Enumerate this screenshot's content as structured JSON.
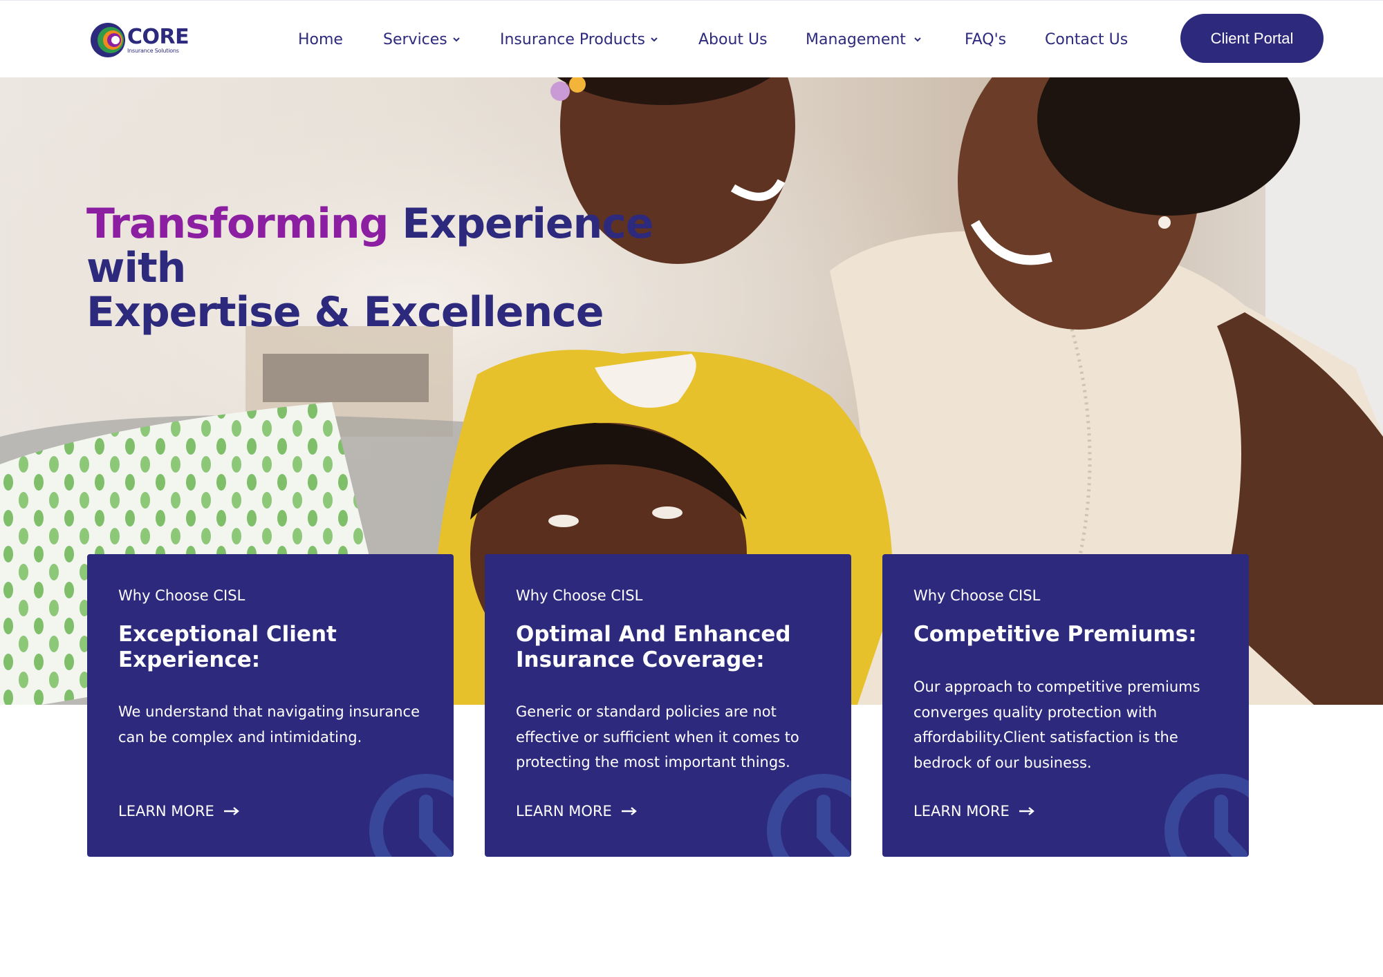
{
  "brand": {
    "name": "CORE",
    "tagline": "Insurance Solutions",
    "colors": {
      "primary": "#2d2a7e",
      "accent": "#8c1fa1",
      "logo_green": "#2e9a4a",
      "logo_orange": "#f08a1c"
    }
  },
  "nav": {
    "items": [
      {
        "label": "Home",
        "has_dropdown": false
      },
      {
        "label": "Services",
        "has_dropdown": true
      },
      {
        "label": "Insurance Products",
        "has_dropdown": true
      },
      {
        "label": "About Us",
        "has_dropdown": false
      },
      {
        "label": "Management",
        "has_dropdown": true
      },
      {
        "label": "FAQ's",
        "has_dropdown": false
      },
      {
        "label": "Contact Us",
        "has_dropdown": false
      }
    ],
    "cta_label": "Client Portal"
  },
  "hero": {
    "title_accent": "Transforming",
    "title_rest_line1": "Experience with",
    "title_line2": "Expertise & Excellence"
  },
  "cards": [
    {
      "eyebrow": "Why Choose CISL",
      "title": "Exceptional Client Experience:",
      "text": "We understand that navigating insurance can be complex and intimidating.",
      "link": "LEARN MORE",
      "icon": "clock-icon"
    },
    {
      "eyebrow": "Why Choose CISL",
      "title": "Optimal And Enhanced Insurance Coverage:",
      "text": "Generic or standard policies are not effective or sufficient when it comes to protecting the most important things.",
      "link": "LEARN MORE",
      "icon": "clock-icon"
    },
    {
      "eyebrow": "Why Choose CISL",
      "title": "Competitive Premiums:",
      "text": "Our approach to competitive premiums converges quality protection with affordability.Client satisfaction is the bedrock of our business.",
      "link": "LEARN MORE",
      "icon": "clock-icon"
    }
  ]
}
